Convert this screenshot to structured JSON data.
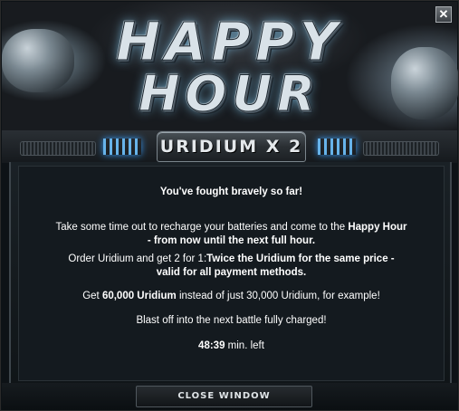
{
  "window": {
    "close_glyph": "✕"
  },
  "banner": {
    "word1": "HAPPY",
    "word2": "HOUR"
  },
  "header": {
    "title": "URIDIUM X 2"
  },
  "message": {
    "intro": "You've fought bravely so far!",
    "p1_part1": "Take some time out to recharge your batteries and come to the ",
    "p1_bold1": "Happy Hour",
    "p1_bold2": "- from now until the next full hour.",
    "p2_part1": "Order Uridium and get 2 for 1:",
    "p2_bold": "Twice the Uridium for the same price -",
    "p2_bold2": "valid for all payment methods.",
    "p3_part1": "Get ",
    "p3_bold": "60,000 Uridium",
    "p3_part2": " instead of just 30,000 Uridium, for example!",
    "p4": "Blast off into the next battle fully charged!",
    "timer_value": "48:39",
    "timer_suffix": " min. left"
  },
  "footer": {
    "close_label": "CLOSE WINDOW"
  },
  "colors": {
    "accent_blue": "#6fc3ff",
    "background": "#141a1f",
    "text": "#ffffff"
  }
}
